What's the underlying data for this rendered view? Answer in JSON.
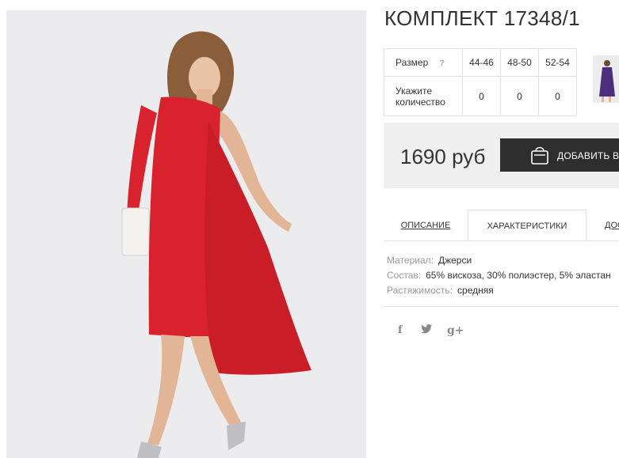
{
  "product": {
    "title": "КОМПЛЕКТ 17348/1"
  },
  "size_table": {
    "size_label": "Размер",
    "help": "?",
    "sizes": [
      "44-46",
      "48-50",
      "52-54"
    ],
    "qty_label": "Укажите количество",
    "quantities": [
      "0",
      "0",
      "0"
    ]
  },
  "price": {
    "value": "1690 руб",
    "add_button": "ДОБАВИТЬ В З"
  },
  "tabs": [
    {
      "label": "ОПИСАНИЕ"
    },
    {
      "label": "ХАРАКТЕРИСТИКИ"
    },
    {
      "label": "ДОС"
    }
  ],
  "characteristics": [
    {
      "key": "Материал:",
      "value": "Джерси"
    },
    {
      "key": "Состав:",
      "value": "65% вискоза, 30% полиэстер, 5% эластан"
    },
    {
      "key": "Растяжимость:",
      "value": "средняя"
    }
  ],
  "social": {
    "facebook": "f",
    "twitter": "twitter-icon",
    "gplus": "g+"
  },
  "colors": {
    "dress": "#d8232e",
    "button": "#2e2e2e",
    "price_bg": "#efefef"
  }
}
